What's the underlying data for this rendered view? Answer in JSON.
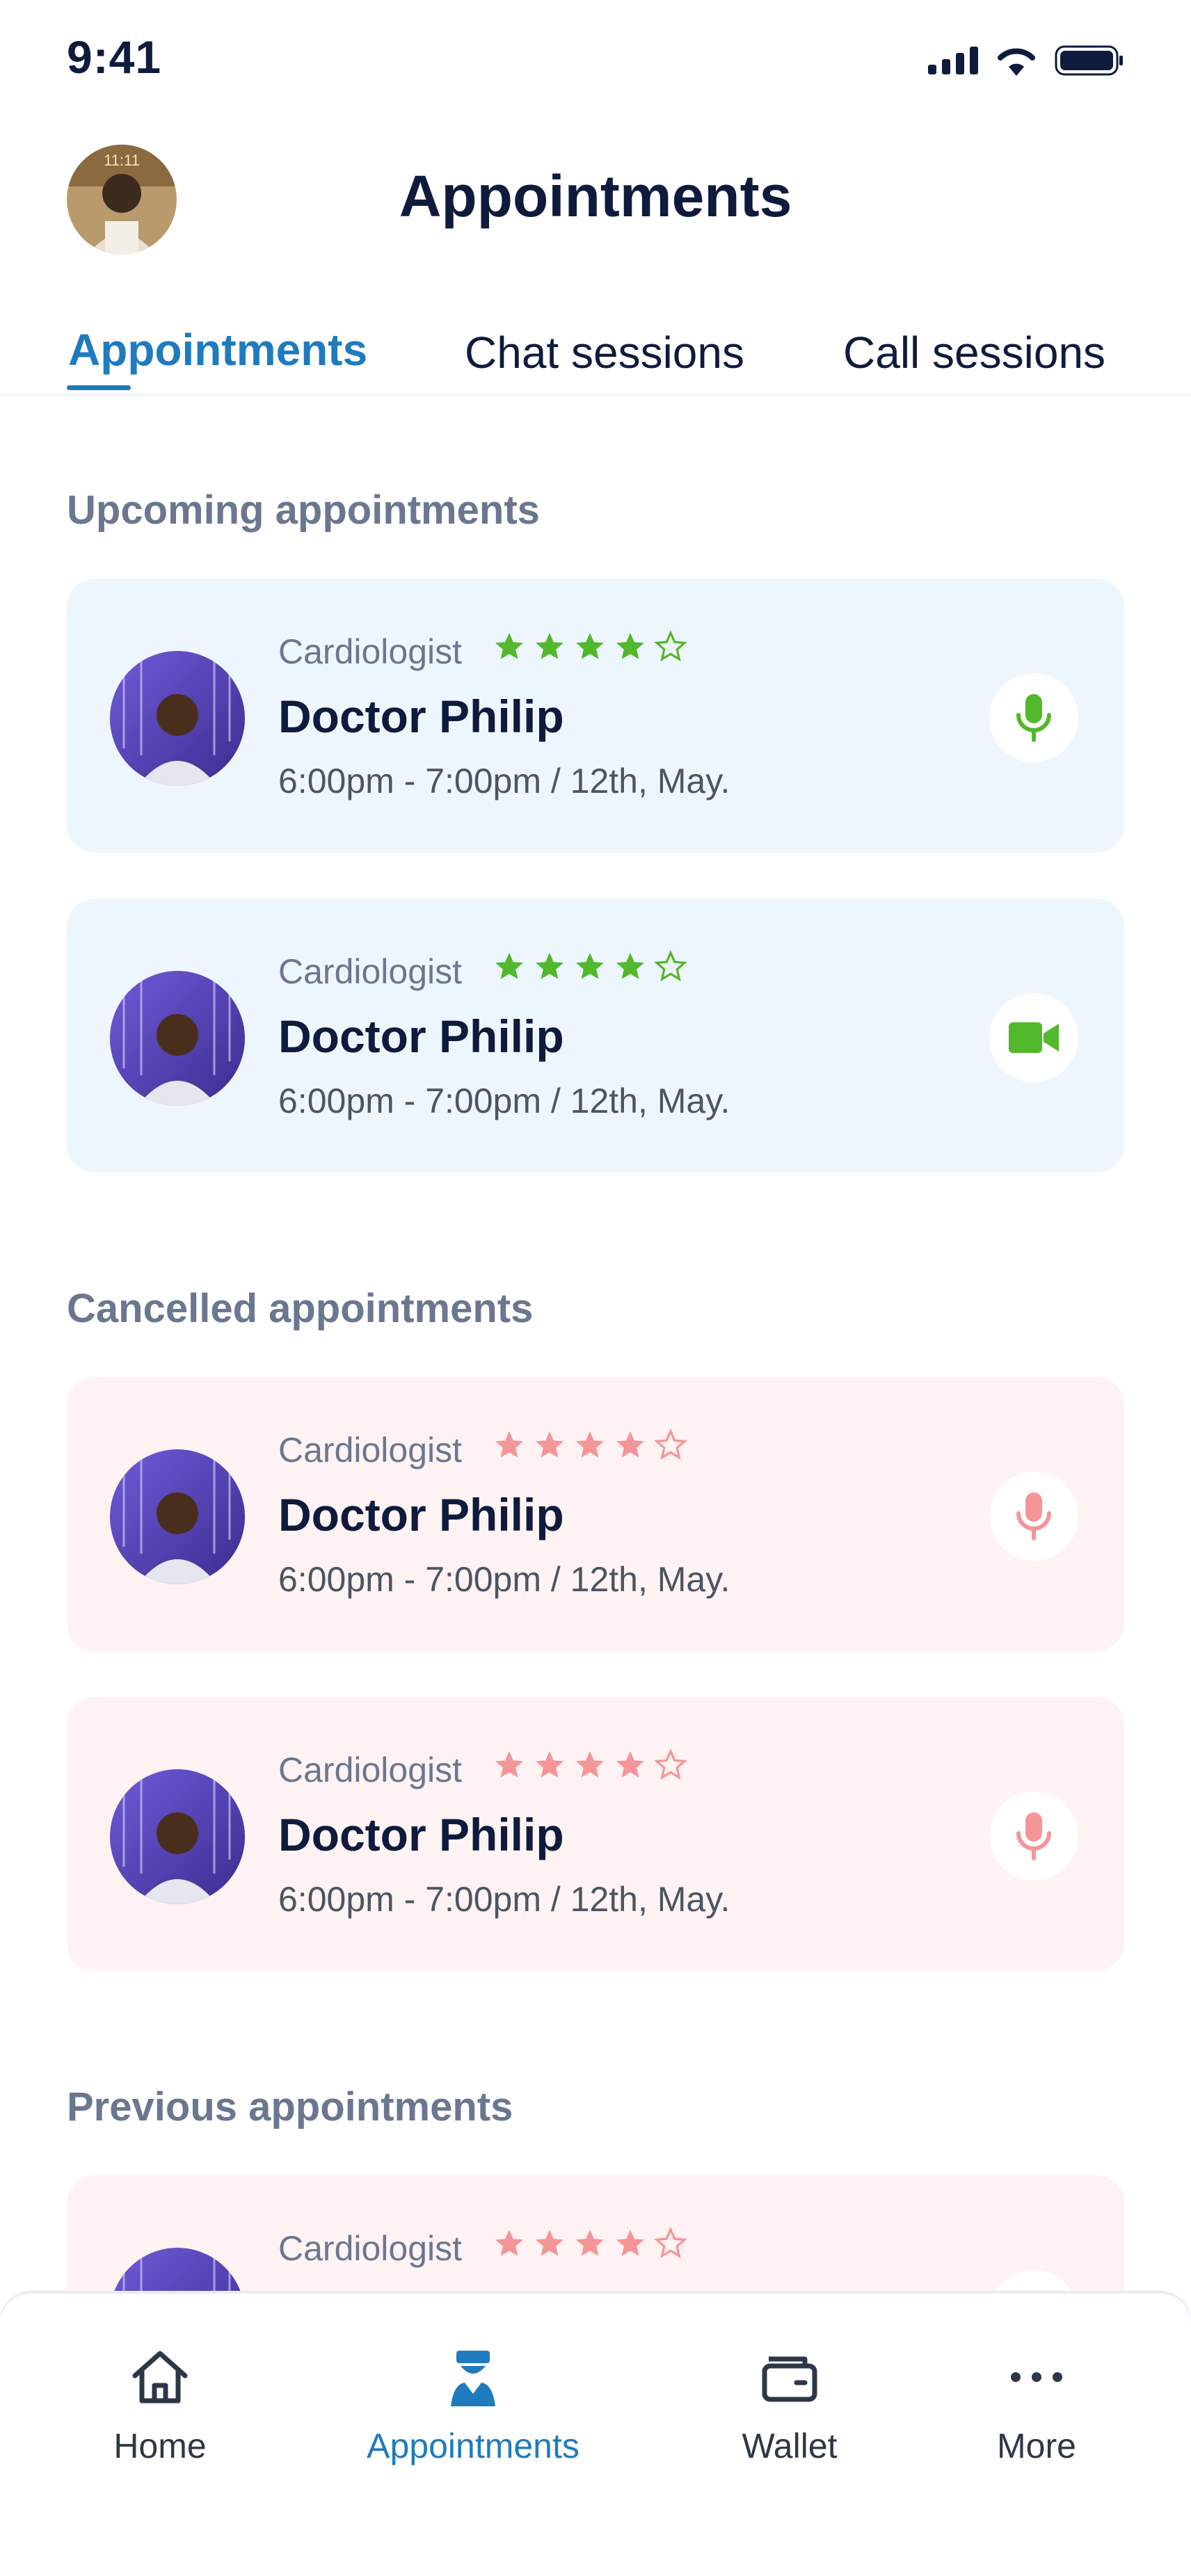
{
  "status_bar": {
    "time": "9:41"
  },
  "header": {
    "title": "Appointments",
    "avatar_overlay_text": "11:11"
  },
  "tabs": [
    {
      "label": "Appointments",
      "active": true
    },
    {
      "label": "Chat sessions",
      "active": false
    },
    {
      "label": "Call sessions",
      "active": false
    }
  ],
  "sections": {
    "upcoming": {
      "title": "Upcoming appointments",
      "items": [
        {
          "specialty": "Cardiologist",
          "rating": 4,
          "name": "Doctor Philip",
          "when": "6:00pm - 7:00pm / 12th, May.",
          "action_icon": "microphone-icon"
        },
        {
          "specialty": "Cardiologist",
          "rating": 4,
          "name": "Doctor Philip",
          "when": "6:00pm - 7:00pm / 12th, May.",
          "action_icon": "video-camera-icon"
        }
      ]
    },
    "cancelled": {
      "title": "Cancelled appointments",
      "items": [
        {
          "specialty": "Cardiologist",
          "rating": 4,
          "name": "Doctor Philip",
          "when": "6:00pm - 7:00pm / 12th, May.",
          "action_icon": "microphone-icon"
        },
        {
          "specialty": "Cardiologist",
          "rating": 4,
          "name": "Doctor Philip",
          "when": "6:00pm - 7:00pm / 12th, May.",
          "action_icon": "microphone-icon"
        }
      ]
    },
    "previous": {
      "title": "Previous appointments",
      "items": [
        {
          "specialty": "Cardiologist",
          "rating": 4,
          "action_icon": "microphone-icon"
        }
      ]
    }
  },
  "bottom_nav": [
    {
      "label": "Home",
      "icon": "home-icon",
      "active": false
    },
    {
      "label": "Appointments",
      "icon": "doctor-icon",
      "active": true
    },
    {
      "label": "Wallet",
      "icon": "wallet-icon",
      "active": false
    },
    {
      "label": "More",
      "icon": "more-dots-icon",
      "active": false
    }
  ],
  "colors": {
    "primary": "#1f7bbd",
    "upcoming_accent": "#52b82c",
    "cancelled_accent": "#f49598",
    "upcoming_card_bg": "#eef6fd",
    "cancelled_card_bg": "#fef2f2",
    "muted_text": "#6b7790",
    "dark_text": "#0f1b3d"
  }
}
